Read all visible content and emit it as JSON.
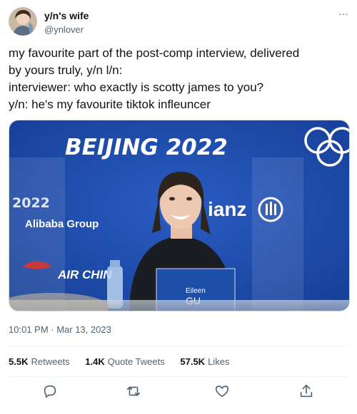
{
  "user": {
    "display_name": "y/n's wife",
    "handle": "@ynlover"
  },
  "tweet": {
    "lines": [
      "my favourite part of the post-comp interview, delivered",
      "by yours truly, y/n l/n:",
      "interviewer: who exactly is scotty james to you?",
      "y/n: he's my favourite tiktok infleuncer"
    ],
    "timestamp": "10:01 PM · Mar 13, 2023"
  },
  "media": {
    "banner_text": "BEIJING 2022",
    "sponsor_alibaba": "Alibaba Group",
    "sponsor_allianz": "ianz",
    "sponsor_airchina": "AIR CHIN",
    "nameplate_first": "Eileen",
    "nameplate_last": "GU"
  },
  "stats": {
    "retweets_count": "5.5K",
    "retweets_label": "Retweets",
    "quotes_count": "1.4K",
    "quotes_label": "Quote Tweets",
    "likes_count": "57.5K",
    "likes_label": "Likes"
  },
  "icons": {
    "more": "more-horizontal-icon",
    "reply": "reply-icon",
    "retweet": "retweet-icon",
    "like": "heart-icon",
    "share": "share-icon"
  },
  "colors": {
    "text_primary": "#0f1419",
    "text_secondary": "#536471",
    "banner_blue": "#1f4fb0"
  }
}
